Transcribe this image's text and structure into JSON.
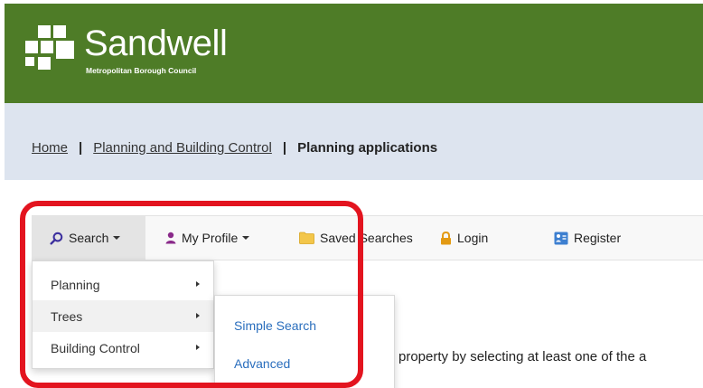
{
  "header": {
    "brand_name": "Sandwell",
    "brand_sub": "Metropolitan Borough Council",
    "bg_color": "#4e7c27",
    "logo_icon": "sandwell-squares-logo"
  },
  "breadcrumb": {
    "items": [
      "Home",
      "Planning and Building Control"
    ],
    "separator": "|",
    "current": "Planning applications"
  },
  "navbar": {
    "search": {
      "label": "Search",
      "icon": "search-icon",
      "active": true
    },
    "profile": {
      "label": "My Profile",
      "icon": "user-icon"
    },
    "saved": {
      "label": "Saved Searches",
      "icon": "folder-icon"
    },
    "login": {
      "label": "Login",
      "icon": "lock-icon"
    },
    "register": {
      "label": "Register",
      "icon": "register-icon"
    }
  },
  "search_menu": {
    "items": [
      "Planning",
      "Trees",
      "Building Control"
    ],
    "hovered": "Trees"
  },
  "trees_submenu": {
    "items": [
      "Simple Search",
      "Advanced"
    ]
  },
  "body_text": "property by selecting at least one of the a",
  "colors": {
    "accent_link": "#2a6ebd",
    "highlight": "#e3141f",
    "crumb_band": "#dde4ef"
  }
}
